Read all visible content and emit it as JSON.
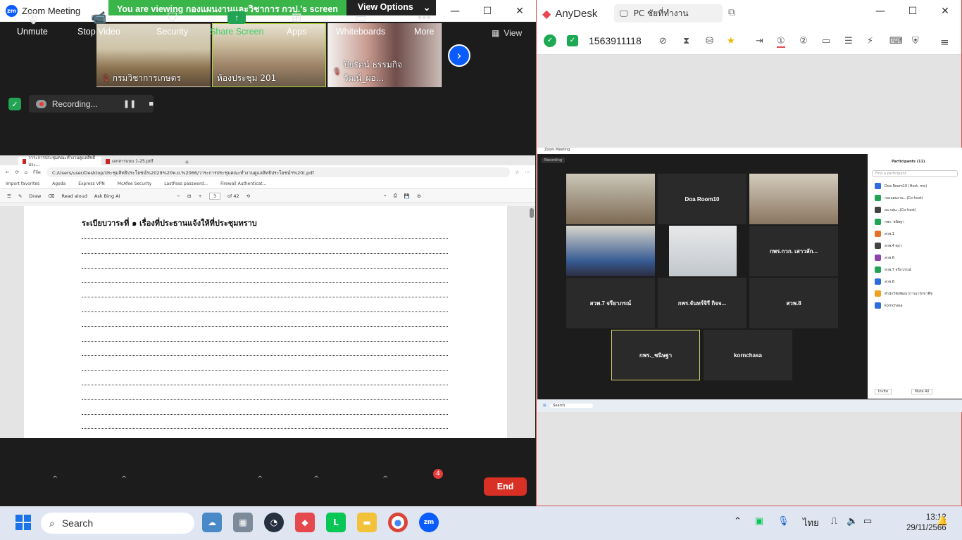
{
  "zoom": {
    "title": "Zoom Meeting",
    "share_banner": "You are viewing กองแผนงานและวิชาการ กวป.'s screen",
    "view_options": "View Options",
    "view_label": "View",
    "participants": [
      {
        "name": "กรมวิชาการเกษตร"
      },
      {
        "name": "ห้องประชุม 201"
      },
      {
        "name": "ปิยรัตน์ ธรรมกิจวัฒน์_ผอ..."
      }
    ],
    "recording": "Recording...",
    "toolbar": {
      "unmute": "Unmute",
      "stop_video": "Stop Video",
      "security": "Security",
      "share_screen": "Share Screen",
      "apps": "Apps",
      "whiteboards": "Whiteboards",
      "more": "More",
      "more_badge": "4",
      "end": "End"
    }
  },
  "browser": {
    "tab1": "วาระการประชุมคณะทำงานดูแลสิทธิประ...",
    "tab2": "เอกสารแนบ 1-25.pdf",
    "file_label": "File",
    "url": "C:/Users/user/Desktop/ประชุมสิทธิประโยชน์%2029%20พ.ย.%2066/วาระการประชุมคณะทำงานดูแลสิทธิประโยชน์ฯ%20(.pdf",
    "favorites": [
      "Import favorites",
      "Agoda",
      "Express VPN",
      "McAfee Security",
      "LastPass password...",
      "Firewall Authenticat..."
    ],
    "pdf_draw": "Draw",
    "pdf_read_aloud": "Read aloud",
    "pdf_ask": "Ask Bing AI",
    "pdf_page": "3",
    "pdf_pages": "of 42"
  },
  "document": {
    "heading": "ระเบียบวาระที่ ๑ เรื่องที่ประธานแจ้งให้ที่ประชุมทราบ"
  },
  "anydesk": {
    "app_name": "AnyDesk",
    "tab_label": "PC ชัยที่ทำงาน",
    "remote_id": "1563911118",
    "remote": {
      "window_title": "Zoom Meeting",
      "recording": "Recording",
      "tiles": [
        "Doa Room10",
        "กพร.กวก. เสาวลัก...",
        "สวพ.7 จรียาภรณ์",
        "กพร.จันทร์จิรี กิจจ...",
        "สวพ.8",
        "กพร._ชนิษฐา",
        "kornchasa"
      ],
      "panel_title": "Participants (11)",
      "panel_search": "Find a participant",
      "panel_rows": [
        "Doa Room10 (Host, me)",
        "กองแผนงาน...(Co-host)",
        "ผอ.กลุ่ม...(Co-host)",
        "กพร. ชนิษฐา",
        "สวพ.1",
        "สวพ.4 ศุภา",
        "สวพ.6",
        "สวพ.7 จรียาภรณ์",
        "สวพ.8",
        "สำนักวิจัยพัฒนาการอารักขาพืช",
        "kornchasa"
      ],
      "invite": "Invite",
      "mute_all": "Mute All",
      "taskbar_search": "Search"
    }
  },
  "taskbar": {
    "search_placeholder": "Search",
    "language": "ไทย",
    "time": "13:12",
    "date": "29/11/2566"
  }
}
